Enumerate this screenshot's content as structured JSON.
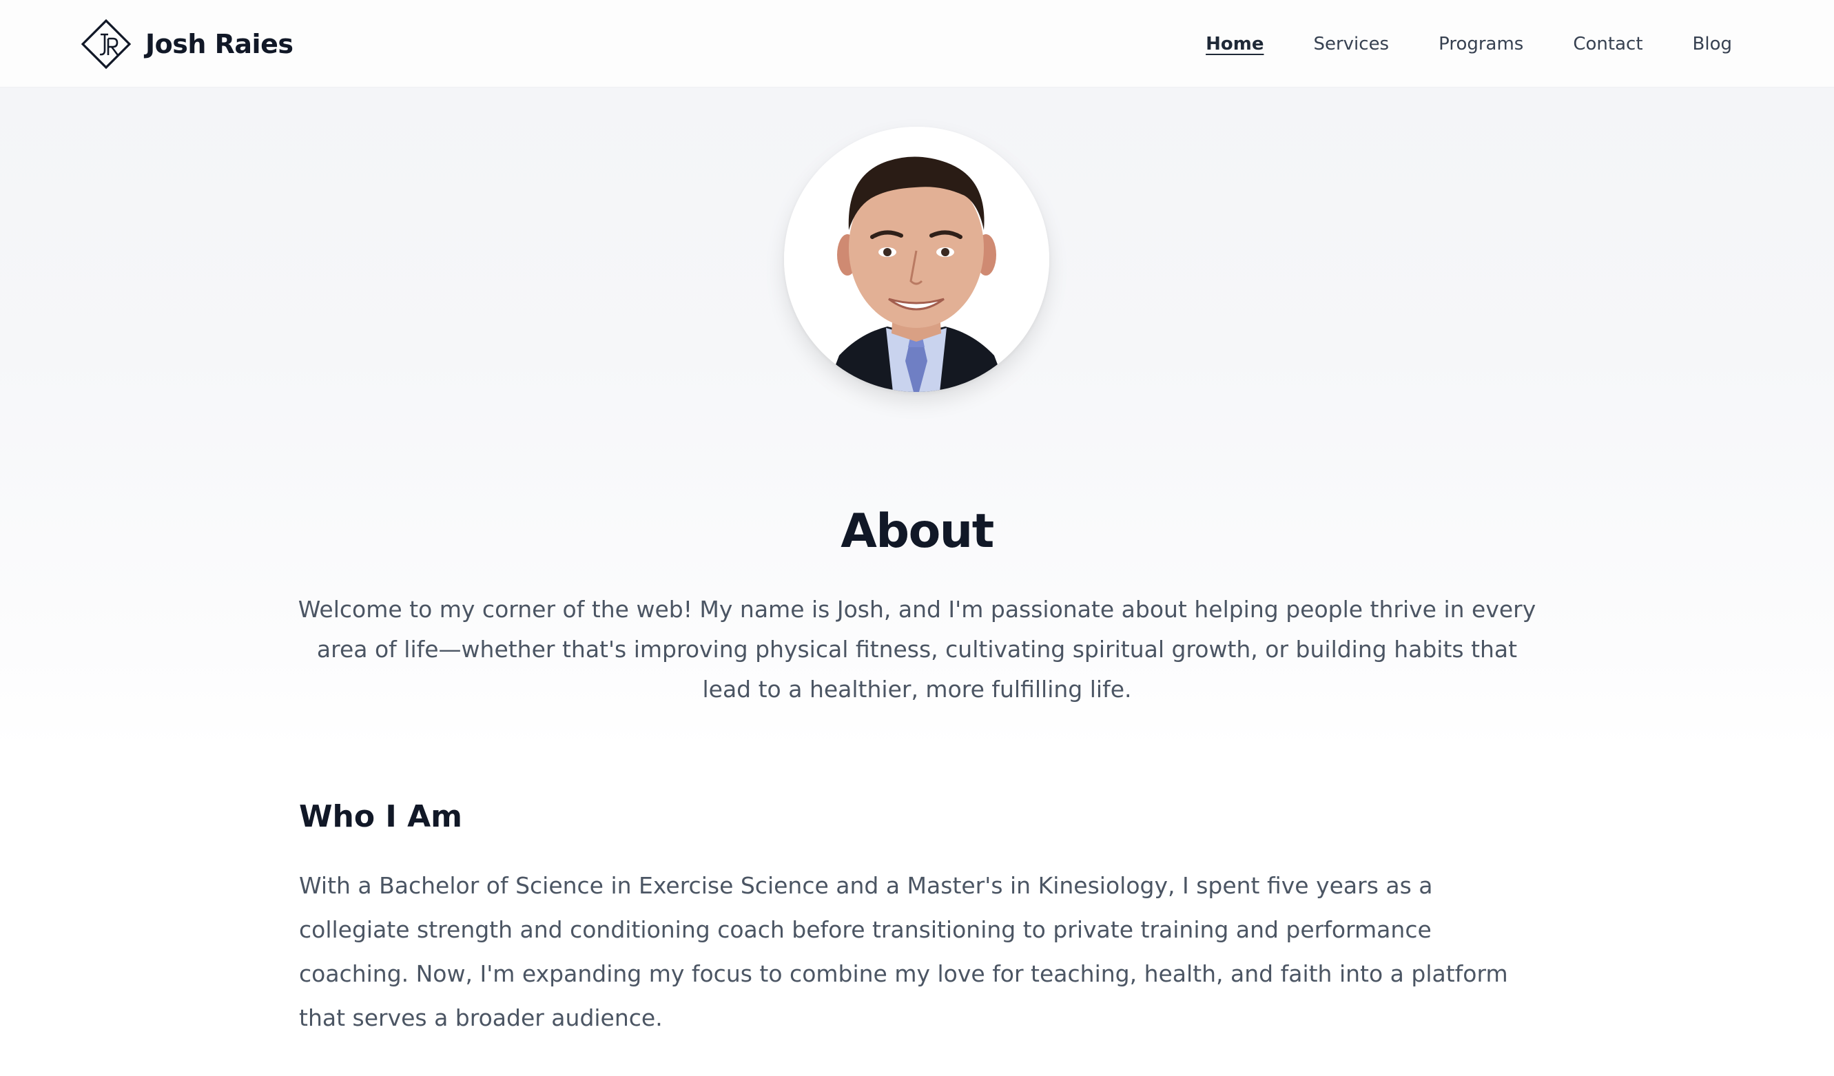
{
  "brand": {
    "name": "Josh Raies",
    "logo_letters": "JR"
  },
  "nav": {
    "items": [
      {
        "label": "Home",
        "active": true
      },
      {
        "label": "Services",
        "active": false
      },
      {
        "label": "Programs",
        "active": false
      },
      {
        "label": "Contact",
        "active": false
      },
      {
        "label": "Blog",
        "active": false
      }
    ]
  },
  "hero": {
    "title": "About",
    "text": "Welcome to my corner of the web! My name is Josh, and I'm passionate about helping people thrive in every area of life—whether that's improving physical fitness, cultivating spiritual growth, or building habits that lead to a healthier, more fulfilling life.",
    "avatar_description": "portrait photo"
  },
  "about": {
    "title": "Who I Am",
    "text": "With a Bachelor of Science in Exercise Science and a Master's in Kinesiology, I spent five years as a collegiate strength and conditioning coach before transitioning to private training and performance coaching. Now, I'm expanding my focus to combine my love for teaching, health, and faith into a platform that serves a broader audience."
  },
  "colors": {
    "text_primary": "#111827",
    "text_body": "#4b5563",
    "nav_text": "#374151",
    "hero_bg": "#f4f5f8",
    "page_bg": "#ffffff"
  }
}
